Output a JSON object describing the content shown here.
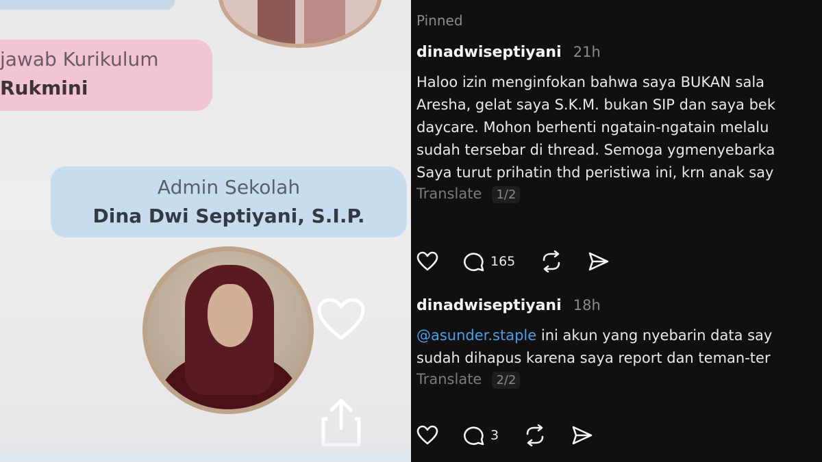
{
  "flyer": {
    "role_1": "jawab Kurikulum",
    "name_1": "Rukmini",
    "role_2": "Admin Sekolah",
    "name_2": "Dina Dwi Septiyani, S.I.P."
  },
  "thread": {
    "pinned_label": "Pinned",
    "posts": [
      {
        "username": "dinadwiseptiyani",
        "time": "21h",
        "lines": [
          "Haloo izin menginfokan bahwa saya BUKAN sala",
          "Aresha, gelat saya S.K.M. bukan SIP dan saya bek",
          "daycare. Mohon berhenti ngatain-ngatain melalu",
          "sudah tersebar di thread. Semoga ygmenyebarka",
          "Saya turut prihatin thd peristiwa ini, krn anak say"
        ],
        "translate": "Translate",
        "counter": "1/2",
        "reply_count": "165"
      },
      {
        "username": "dinadwiseptiyani",
        "time": "18h",
        "mention": "@asunder.staple",
        "line_1_rest": " ini akun yang nyebarin data say",
        "line_2": "sudah dihapus karena saya report dan teman-ter",
        "translate": "Translate",
        "counter": "2/2",
        "reply_count": "3"
      }
    ]
  },
  "icons": {
    "like": "heart-icon",
    "reply": "comment-icon",
    "repost": "repost-icon",
    "share": "send-icon"
  },
  "colors": {
    "panel_bg": "#101010",
    "mention": "#4a9ee8",
    "pink_pill": "#f2c4d4",
    "blue_pill": "#c8dcef"
  }
}
